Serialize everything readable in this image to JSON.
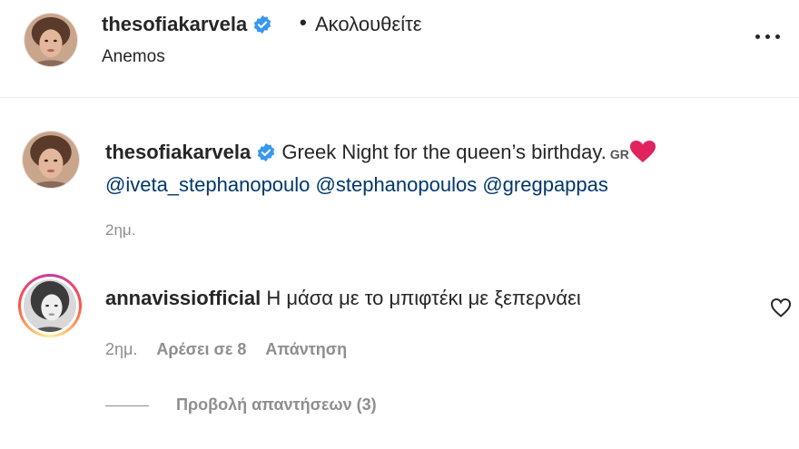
{
  "header": {
    "username": "thesofiakarvela",
    "separator": "•",
    "follow_status": "Ακολουθείτε",
    "location": "Anemos",
    "more_icon": "more-horizontal-icon"
  },
  "caption": {
    "username": "thesofiakarvela",
    "text": "Greek Night for the queen’s birthday.",
    "flag_text": "GR",
    "emoji": "red-heart-icon",
    "mentions": [
      "@iveta_stephanopoulo",
      "@stephanopoulos",
      "@gregpappas"
    ],
    "time": "2ημ."
  },
  "comment": {
    "username": "annavissiofficial",
    "text": "Η μάσα με το μπιφτέκι με ξεπερνάει",
    "time": "2ημ.",
    "likes": "Αρέσει σε 8",
    "reply": "Απάντηση",
    "view_replies": "Προβολή απαντήσεων (3)",
    "like_icon": "heart-outline-icon"
  },
  "colors": {
    "text": "#262626",
    "secondary": "#8e8e8e",
    "mention": "#00376b",
    "verified": "#3897f0",
    "heart": "#e0245e"
  }
}
